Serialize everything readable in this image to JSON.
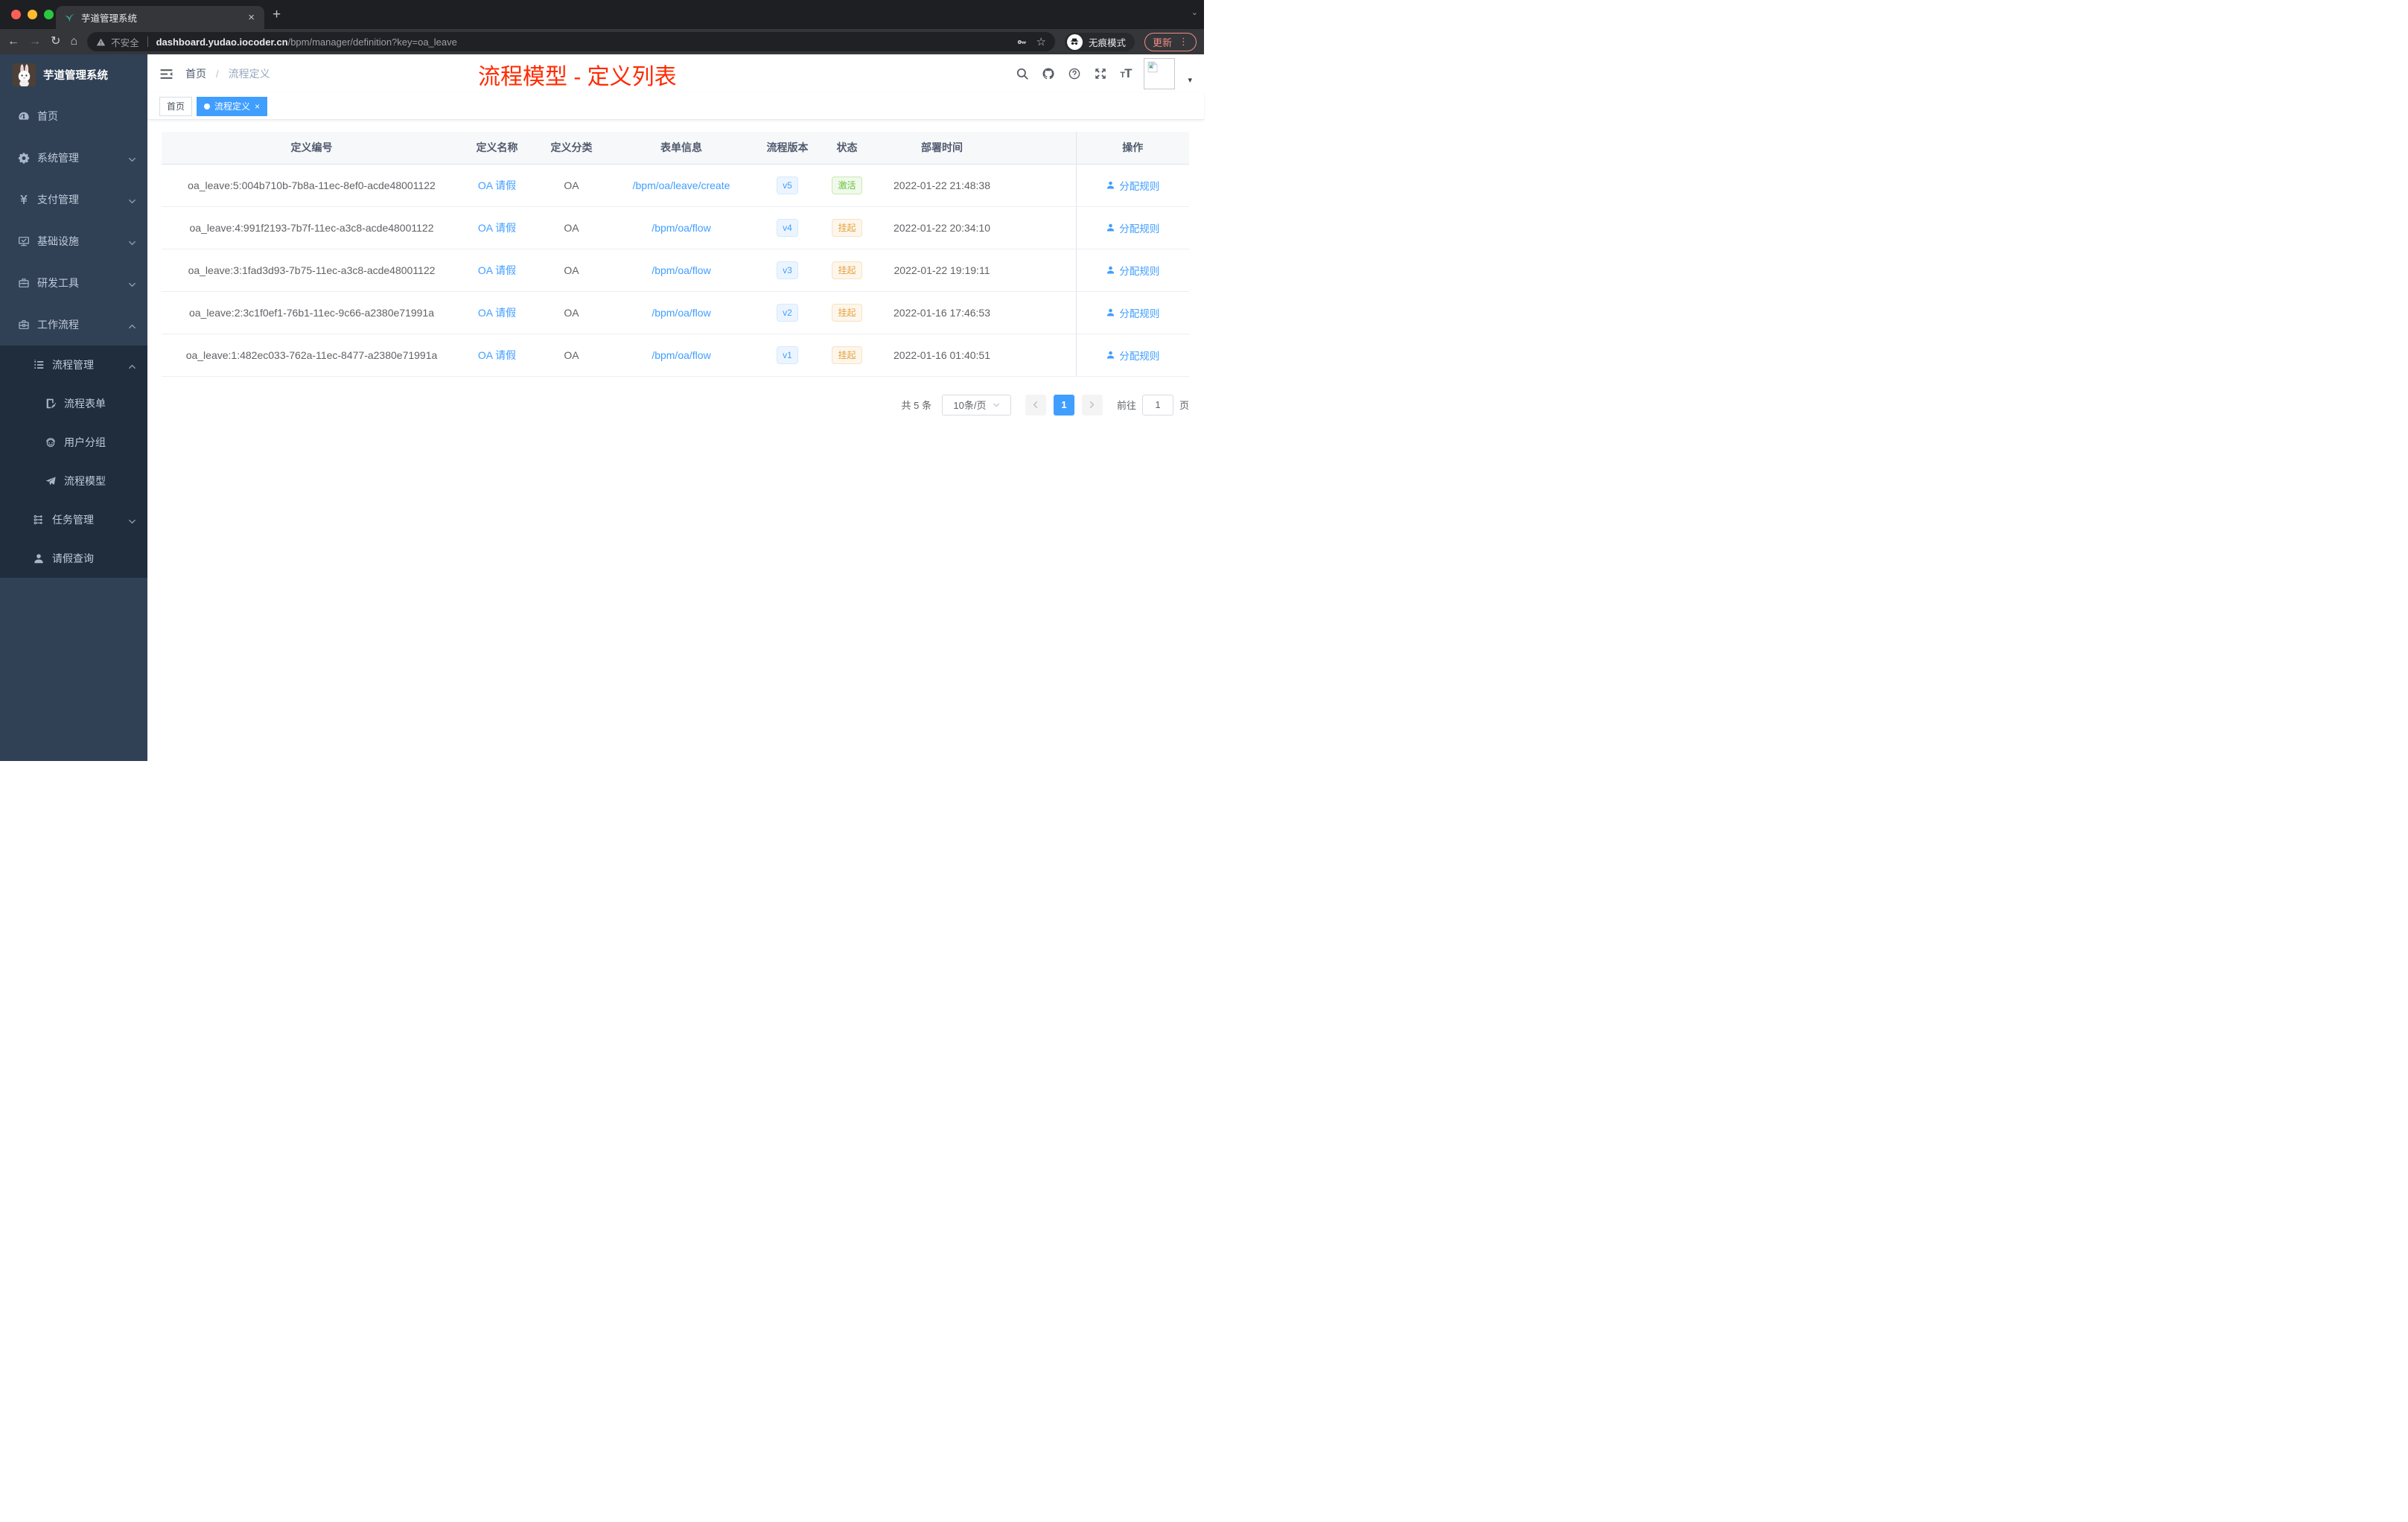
{
  "browser": {
    "tab_title": "芋道管理系统",
    "new_tab_glyph": "+",
    "security_label": "不安全",
    "url_host": "dashboard.yudao.iocoder.cn",
    "url_path": "/bpm/manager/definition?key=oa_leave",
    "incognito_label": "无痕模式",
    "update_label": "更新",
    "menu_dots": "⋮",
    "back_glyph": "←",
    "forward_glyph": "→",
    "reload_glyph": "↻",
    "home_glyph": "⌂",
    "star_glyph": "☆",
    "window_caret": "⌄"
  },
  "sidebar": {
    "logo_title": "芋道管理系统",
    "items": [
      {
        "key": "home",
        "label": "首页",
        "icon": "dashboard-icon",
        "level": 1,
        "chevron": null,
        "dark": false
      },
      {
        "key": "system",
        "label": "系统管理",
        "icon": "gear-icon",
        "level": 1,
        "chevron": "down",
        "dark": false
      },
      {
        "key": "payment",
        "label": "支付管理",
        "icon": "money-icon",
        "level": 1,
        "chevron": "down",
        "dark": false
      },
      {
        "key": "infrastructure",
        "label": "基础设施",
        "icon": "monitor-icon",
        "level": 1,
        "chevron": "down",
        "dark": false
      },
      {
        "key": "devtools",
        "label": "研发工具",
        "icon": "toolbox-icon",
        "level": 1,
        "chevron": "down",
        "dark": false
      },
      {
        "key": "workflow",
        "label": "工作流程",
        "icon": "workflow-icon",
        "level": 1,
        "chevron": "up",
        "dark": false
      },
      {
        "key": "process-manage",
        "label": "流程管理",
        "icon": "list-icon",
        "level": 2,
        "chevron": "up",
        "dark": true
      },
      {
        "key": "process-form",
        "label": "流程表单",
        "icon": "form-icon",
        "level": 3,
        "chevron": null,
        "dark": true
      },
      {
        "key": "user-group",
        "label": "用户分组",
        "icon": "user-group-icon",
        "level": 3,
        "chevron": null,
        "dark": true
      },
      {
        "key": "process-model",
        "label": "流程模型",
        "icon": "paper-plane-icon",
        "level": 3,
        "chevron": null,
        "dark": true
      },
      {
        "key": "task-manage",
        "label": "任务管理",
        "icon": "tree-icon",
        "level": 2,
        "chevron": "down",
        "dark": true
      },
      {
        "key": "leave-query",
        "label": "请假查询",
        "icon": "person-icon",
        "level": 2,
        "chevron": null,
        "dark": true
      }
    ]
  },
  "navbar": {
    "breadcrumb_home": "首页",
    "breadcrumb_separator": "/",
    "breadcrumb_current": "流程定义",
    "annotation_title": "流程模型 - 定义列表"
  },
  "tags": {
    "home_label": "首页",
    "active_label": "流程定义",
    "close_glyph": "×"
  },
  "table": {
    "columns": [
      "定义编号",
      "定义名称",
      "定义分类",
      "表单信息",
      "流程版本",
      "状态",
      "部署时间",
      "操作"
    ],
    "rows": [
      {
        "id": "oa_leave:5:004b710b-7b8a-11ec-8ef0-acde48001122",
        "name": "OA 请假",
        "category": "OA",
        "form": "/bpm/oa/leave/create",
        "version": "v5",
        "status": "激活",
        "status_type": "success",
        "deployed_at": "2022-01-22 21:48:38",
        "action": "分配规则"
      },
      {
        "id": "oa_leave:4:991f2193-7b7f-11ec-a3c8-acde48001122",
        "name": "OA 请假",
        "category": "OA",
        "form": "/bpm/oa/flow",
        "version": "v4",
        "status": "挂起",
        "status_type": "warning",
        "deployed_at": "2022-01-22 20:34:10",
        "action": "分配规则"
      },
      {
        "id": "oa_leave:3:1fad3d93-7b75-11ec-a3c8-acde48001122",
        "name": "OA 请假",
        "category": "OA",
        "form": "/bpm/oa/flow",
        "version": "v3",
        "status": "挂起",
        "status_type": "warning",
        "deployed_at": "2022-01-22 19:19:11",
        "action": "分配规则"
      },
      {
        "id": "oa_leave:2:3c1f0ef1-76b1-11ec-9c66-a2380e71991a",
        "name": "OA 请假",
        "category": "OA",
        "form": "/bpm/oa/flow",
        "version": "v2",
        "status": "挂起",
        "status_type": "warning",
        "deployed_at": "2022-01-16 17:46:53",
        "action": "分配规则"
      },
      {
        "id": "oa_leave:1:482ec033-762a-11ec-8477-a2380e71991a",
        "name": "OA 请假",
        "category": "OA",
        "form": "/bpm/oa/flow",
        "version": "v1",
        "status": "挂起",
        "status_type": "warning",
        "deployed_at": "2022-01-16 01:40:51",
        "action": "分配规则"
      }
    ]
  },
  "pagination": {
    "total_label": "共 5 条",
    "page_size_label": "10条/页",
    "current_page": "1",
    "goto_label": "前往",
    "goto_value": "1",
    "page_unit_label": "页"
  },
  "colors": {
    "accent": "#409eff",
    "annotation_red": "#ff2a00",
    "sidebar_bg": "#304156",
    "submenu_bg": "#1f2d3d",
    "success": "#67c23a",
    "warning": "#e6a23c"
  }
}
